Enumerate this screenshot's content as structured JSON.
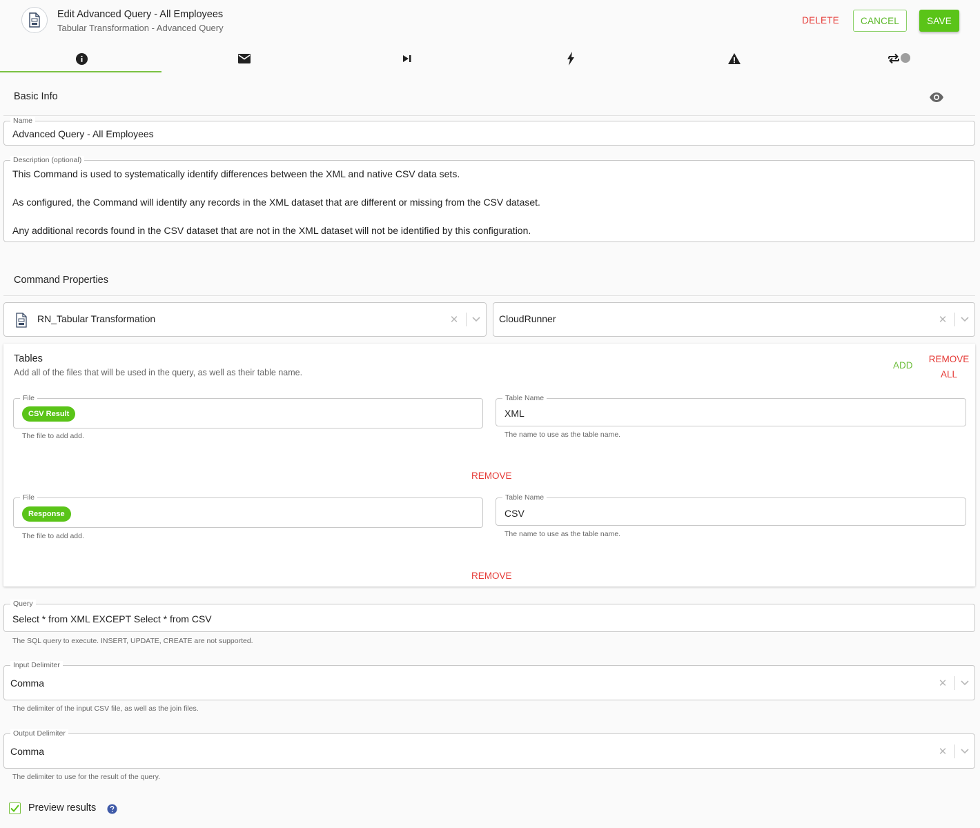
{
  "header": {
    "title": "Edit Advanced Query - All Employees",
    "subtitle": "Tabular Transformation - Advanced Query",
    "delete_label": "DELETE",
    "cancel_label": "CANCEL",
    "save_label": "SAVE"
  },
  "tabs": [
    {
      "icon": "info-icon"
    },
    {
      "icon": "mail-icon"
    },
    {
      "icon": "skip-next-icon"
    },
    {
      "icon": "flash-icon"
    },
    {
      "icon": "warning-icon"
    },
    {
      "icon": "repeat-toggle-icon"
    }
  ],
  "basic_info": {
    "title": "Basic Info",
    "name_label": "Name",
    "name_value": "Advanced Query - All Employees",
    "description_label": "Description (optional)",
    "description_lines": [
      "This Command is used to systematically identify differences between the XML and native CSV data sets.",
      "As configured, the Command will identify any records in the XML dataset that are different or missing from the CSV dataset.",
      "Any additional records found in the CSV dataset that are not in the XML dataset will not be identified by this configuration."
    ]
  },
  "command_properties": {
    "title": "Command Properties",
    "connector_value": "RN_Tabular Transformation",
    "runner_value": "CloudRunner"
  },
  "tables": {
    "title": "Tables",
    "subtitle": "Add all of the files that will be used in the query, as well as their table name.",
    "add_label": "ADD",
    "remove_all_line1": "REMOVE",
    "remove_all_line2": "ALL",
    "rows": [
      {
        "file_label": "File",
        "file_chip": "CSV Result",
        "file_helper": "The file to add add.",
        "table_label": "Table Name",
        "table_value": "XML",
        "table_helper": "The name to use as the table name.",
        "remove_label": "REMOVE"
      },
      {
        "file_label": "File",
        "file_chip": "Response",
        "file_helper": "The file to add add.",
        "table_label": "Table Name",
        "table_value": "CSV",
        "table_helper": "The name to use as the table name.",
        "remove_label": "REMOVE"
      }
    ]
  },
  "query": {
    "label": "Query",
    "value": "Select * from XML EXCEPT Select * from CSV",
    "helper": "The SQL query to execute. INSERT, UPDATE, CREATE are not supported."
  },
  "input_delimiter": {
    "label": "Input Delimiter",
    "value": "Comma",
    "helper": "The delimiter of the input CSV file, as well as the join files."
  },
  "output_delimiter": {
    "label": "Output Delimiter",
    "value": "Comma",
    "helper": "The delimiter to use for the result of the query."
  },
  "preview": {
    "label": "Preview results",
    "checked": true
  },
  "colors": {
    "accent_green": "#5ac418",
    "danger_red": "#e53935"
  }
}
